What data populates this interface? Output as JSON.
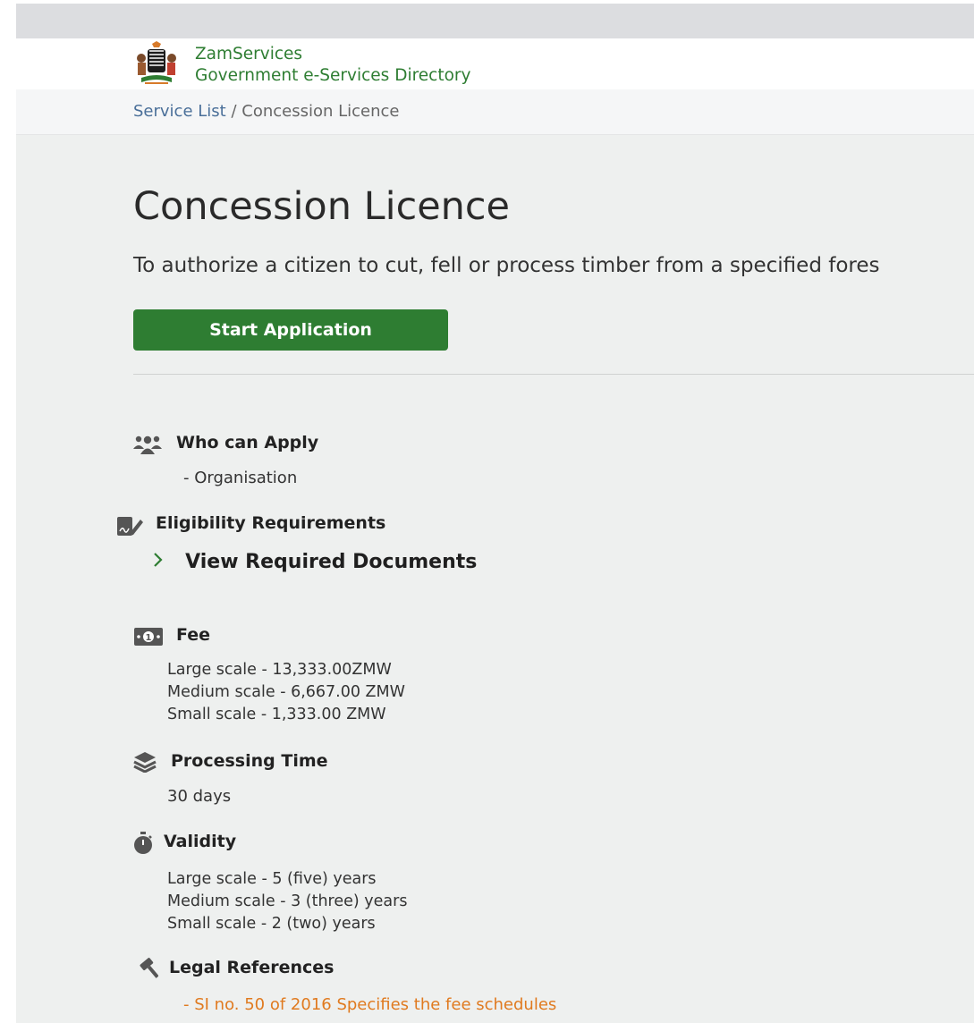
{
  "header": {
    "brand_name": "ZamServices",
    "brand_tagline": "Government e-Services Directory",
    "logo_icon": "coat-of-arms-icon"
  },
  "breadcrumb": {
    "home": "Service List",
    "separator": "/",
    "current": "Concession Licence"
  },
  "service": {
    "title": "Concession Licence",
    "description": "To authorize a citizen to cut, fell or process timber from a specified fores",
    "start_button": "Start Application"
  },
  "sections": {
    "who": {
      "icon": "users-icon",
      "title": "Who can Apply",
      "items": [
        "- Organisation"
      ]
    },
    "eligibility": {
      "icon": "document-sign-icon",
      "title": "Eligibility Requirements",
      "link": "View Required Documents",
      "link_icon": "chevron-right-icon"
    },
    "fee": {
      "icon": "money-bill-icon",
      "title": "Fee",
      "lines": [
        "Large scale - 13,333.00ZMW",
        "Medium scale - 6,667.00 ZMW",
        "Small scale - 1,333.00 ZMW"
      ]
    },
    "processing": {
      "icon": "layers-icon",
      "title": "Processing Time",
      "value": "30 days"
    },
    "validity": {
      "icon": "stopwatch-icon",
      "title": "Validity",
      "lines": [
        "Large scale - 5 (five) years",
        "Medium scale - 3 (three) years",
        "Small scale - 2 (two) years"
      ]
    },
    "legal": {
      "icon": "gavel-icon",
      "title": "Legal References",
      "items": [
        "- SI no. 50 of 2016 Specifies the fee schedules"
      ]
    }
  },
  "colors": {
    "brand_green": "#2e7d32",
    "link_blue": "#4a6f99",
    "legal_orange": "#e07a1f",
    "page_background": "#eef0ef"
  }
}
